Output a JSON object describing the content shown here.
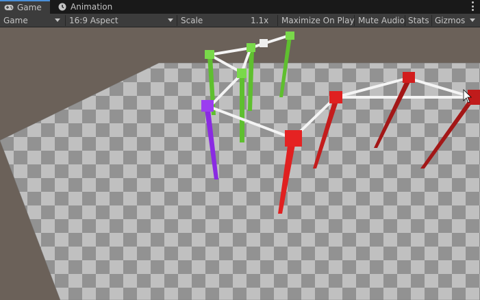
{
  "tabs": {
    "game": "Game",
    "animation": "Animation"
  },
  "toolbar": {
    "display": "Game",
    "aspect": "16:9 Aspect",
    "scale_label": "Scale",
    "scale_value": "1.1x",
    "maximize": "Maximize On Play",
    "mute": "Mute Audio",
    "stats": "Stats",
    "gizmos": "Gizmos"
  },
  "scene": {
    "sky_color": "#6b6159",
    "floor_light": "#cbcbcb",
    "floor_dark": "#9a9a9a",
    "object_colors": [
      "#e02020",
      "#72d43a",
      "#8a2be2",
      "#f0f0f0"
    ],
    "icons": [
      "gamepad-icon",
      "clock-icon",
      "mouse-cursor-icon"
    ]
  }
}
